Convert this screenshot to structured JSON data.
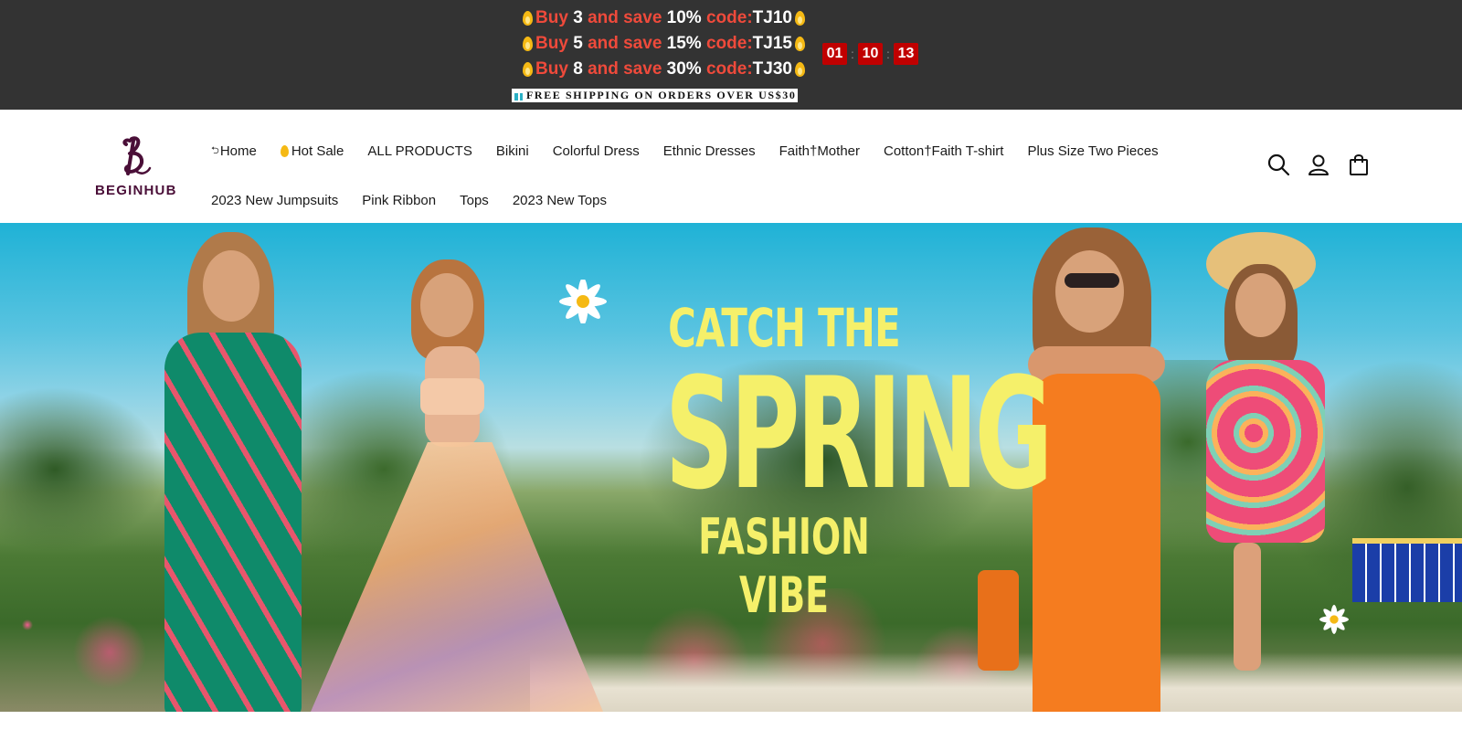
{
  "announcement": {
    "promos": [
      {
        "buy": "Buy",
        "qty": "3",
        "save": "and save",
        "pct": "10%",
        "code_label": "code:",
        "code": "TJ10"
      },
      {
        "buy": "Buy",
        "qty": "5",
        "save": "and save",
        "pct": "15%",
        "code_label": "code:",
        "code": "TJ15"
      },
      {
        "buy": "Buy",
        "qty": "8",
        "save": "and save",
        "pct": "30%",
        "code_label": "code:",
        "code": "TJ30"
      }
    ],
    "countdown": [
      "01",
      "10",
      "13"
    ],
    "shipping": "FREE SHIPPING ON ORDERS OVER US$30",
    "colors": {
      "background": "#333333",
      "accent_red": "#ef4a3b",
      "timer_red": "#c00000"
    }
  },
  "header": {
    "logo_text": "BEGINHUB",
    "brand_color": "#4a0f38",
    "nav_row1": [
      {
        "label": "Home",
        "icon": "back-icon"
      },
      {
        "label": "Hot Sale",
        "icon": "flame-icon"
      },
      {
        "label": "ALL PRODUCTS"
      },
      {
        "label": "Bikini"
      },
      {
        "label": "Colorful Dress"
      },
      {
        "label": "Ethnic Dresses"
      },
      {
        "label": "Faith†Mother"
      },
      {
        "label": "Cotton†Faith T-shirt"
      },
      {
        "label": "Plus Size Two Pieces"
      }
    ],
    "nav_row2": [
      {
        "label": "2023 New Jumpsuits"
      },
      {
        "label": "Pink Ribbon"
      },
      {
        "label": "Tops"
      },
      {
        "label": "2023 New Tops"
      }
    ],
    "icons": [
      "search-icon",
      "account-icon",
      "cart-icon"
    ]
  },
  "hero": {
    "line1": "CATCH THE",
    "line2": "SPRING",
    "line3": "FASHION VIBE",
    "text_color": "#f5f06a"
  }
}
